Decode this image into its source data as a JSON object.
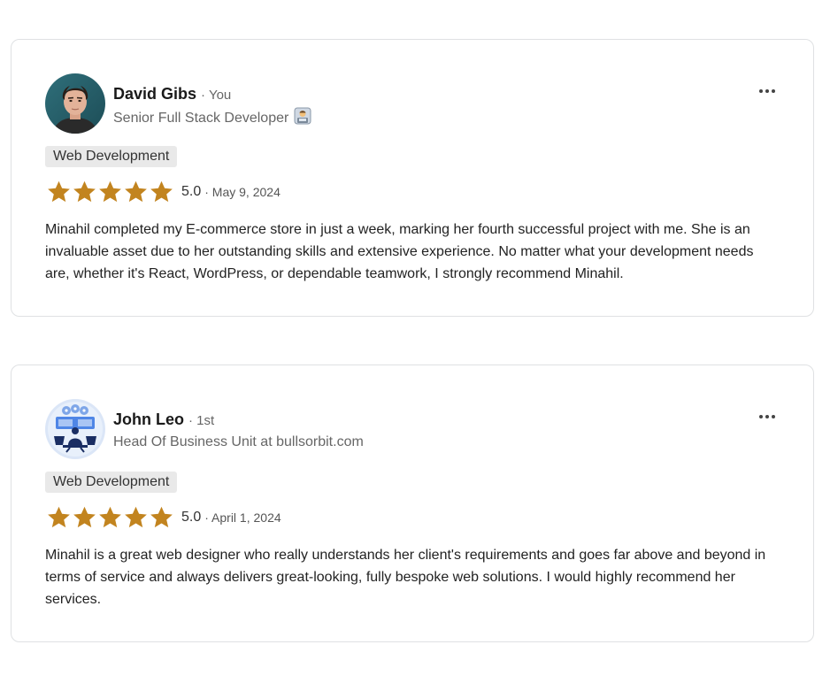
{
  "reviews": [
    {
      "name": "David Gibs",
      "relationship": "· You",
      "headline": "Senior Full Stack Developer",
      "headline_emoji": "technologist-emoji-icon",
      "tag": "Web Development",
      "stars": 5,
      "score": "5.0",
      "date": "· May 9, 2024",
      "text": "Minahil completed my E-commerce store in just a week, marking her fourth successful project with me. She is an invaluable asset due to her outstanding skills and extensive experience. No matter what your development needs are, whether it's React, WordPress, or dependable teamwork, I strongly recommend Minahil."
    },
    {
      "name": "John Leo",
      "relationship": "· 1st",
      "headline": "Head Of Business Unit at bullsorbit.com",
      "tag": "Web Development",
      "stars": 5,
      "score": "5.0",
      "date": "· April 1, 2024",
      "text": "Minahil is a great web designer who really understands her client's requirements and goes far above and beyond in terms of service and always delivers great-looking, fully bespoke web solutions. I would highly recommend her services."
    }
  ],
  "colors": {
    "star": "#c2841f",
    "tag_bg": "#e9e9e9",
    "card_border": "#dfe1e3",
    "muted_text": "#666666"
  },
  "icons": {
    "more": "more-options-icon",
    "star": "star-icon"
  }
}
